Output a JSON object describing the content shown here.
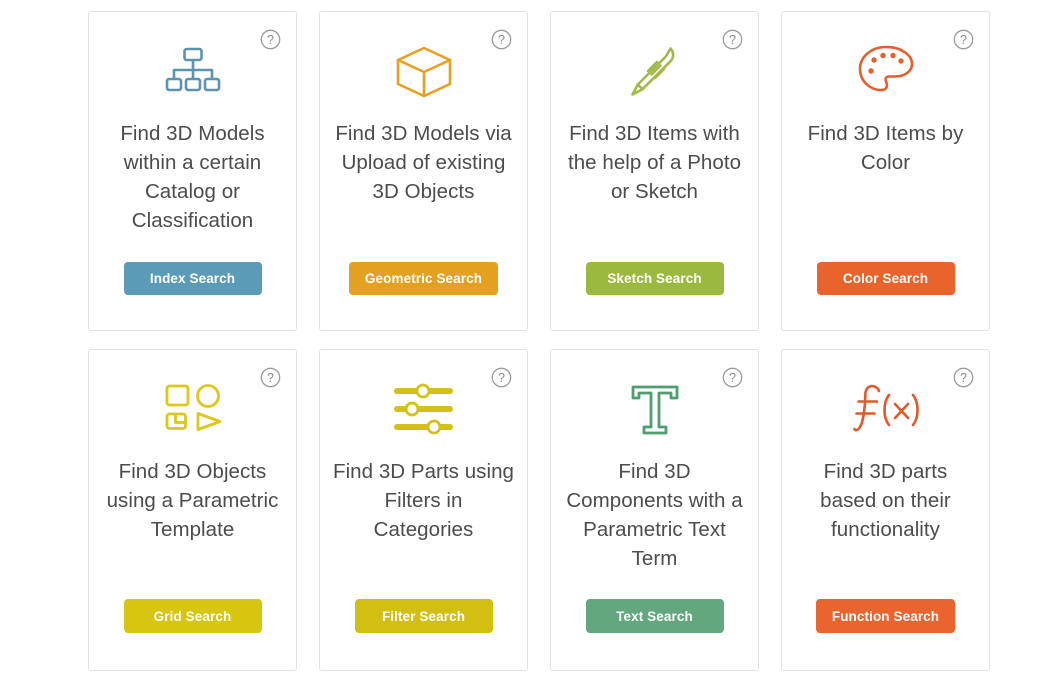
{
  "page": {
    "background": "#ffffff",
    "card_border_color": "#e2e2e2",
    "title_color": "#4c4c4c",
    "help_icon_color": "#9b9b9b",
    "help_icon_name": "help-circle-icon",
    "help_icon_glyph": "?"
  },
  "cards": [
    {
      "id": "index-search",
      "icon_name": "sitemap-icon",
      "icon_color": "#5b93b0",
      "title": "Find 3D Models within a certain Catalog or Classification",
      "button_label": "Index Search",
      "button_color": "#5b9bb8"
    },
    {
      "id": "geometric-search",
      "icon_name": "cube-icon",
      "icon_color": "#e8a021",
      "title": "Find 3D Models via Upload of existing 3D Objects",
      "button_label": "Geometric Search",
      "button_color": "#e3a021"
    },
    {
      "id": "sketch-search",
      "icon_name": "pencil-icon",
      "icon_color": "#a2b94a",
      "title": "Find 3D Items with the help of a Photo or Sketch",
      "button_label": "Sketch Search",
      "button_color": "#9cb93f"
    },
    {
      "id": "color-search",
      "icon_name": "palette-icon",
      "icon_color": "#e25f2e",
      "title": "Find 3D Items by Color",
      "button_label": "Color Search",
      "button_color": "#e8642c"
    },
    {
      "id": "grid-search",
      "icon_name": "shapes-grid-icon",
      "icon_color": "#dbc81a",
      "title": "Find 3D Objects using a Parametric Template",
      "button_label": "Grid Search",
      "button_color": "#d7c50f"
    },
    {
      "id": "filter-search",
      "icon_name": "sliders-icon",
      "icon_color": "#d5c019",
      "title": "Find 3D Parts using Filters in Categories",
      "button_label": "Filter Search",
      "button_color": "#d3be12"
    },
    {
      "id": "text-search",
      "icon_name": "text-t-icon",
      "icon_color": "#4e9e72",
      "title": "Find 3D Components with a Parametric Text Term",
      "button_label": "Text Search",
      "button_color": "#63a77f"
    },
    {
      "id": "function-search",
      "icon_name": "function-fx-icon",
      "icon_color": "#e05a2b",
      "title": "Find 3D parts based on their functionality",
      "button_label": "Function Search",
      "button_color": "#ea6430"
    }
  ]
}
